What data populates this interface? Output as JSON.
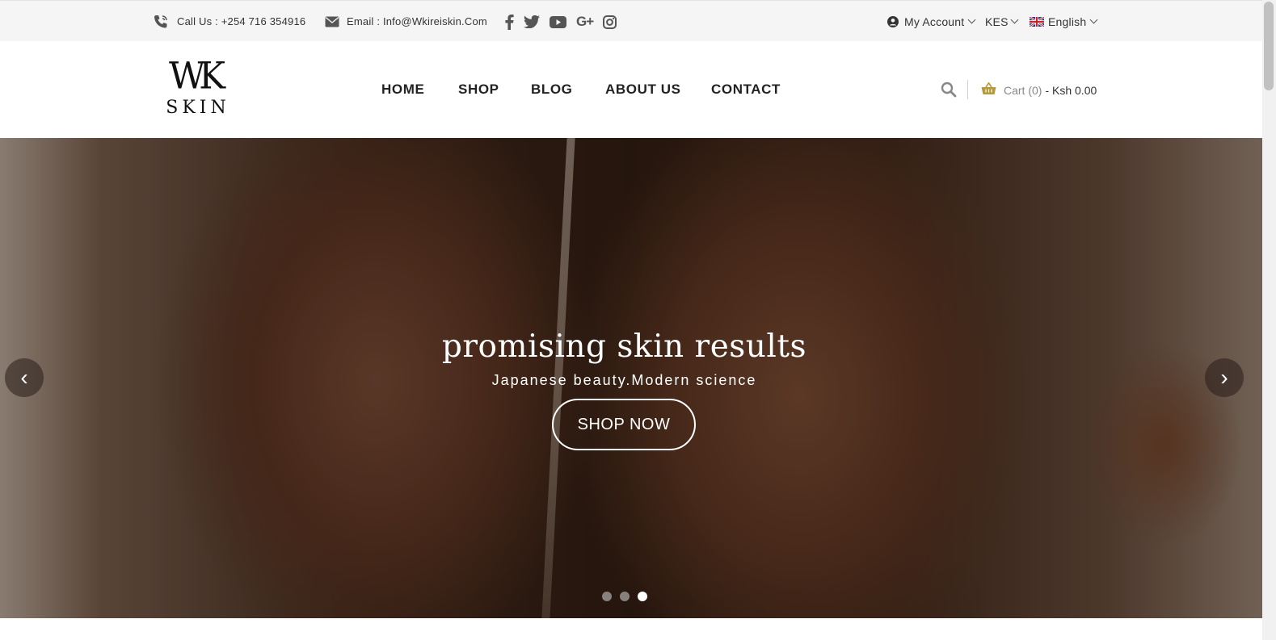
{
  "topbar": {
    "phone_label": "Call Us : +254 716 354916",
    "email_label": "Email : Info@Wkireiskin.Com",
    "social_icons": [
      "facebook-icon",
      "twitter-icon",
      "youtube-icon",
      "google-plus-icon",
      "instagram-icon"
    ],
    "account_label": "My Account",
    "currency_label": "KES",
    "language_label": "English"
  },
  "header": {
    "logo_mark": "WK",
    "logo_word": "SKIN",
    "nav": [
      {
        "label": "HOME"
      },
      {
        "label": "SHOP"
      },
      {
        "label": "BLOG"
      },
      {
        "label": "ABOUT US"
      },
      {
        "label": "CONTACT"
      }
    ],
    "cart_label": "Cart (0)",
    "cart_amount": "- Ksh 0.00"
  },
  "hero": {
    "title": "promising skin results",
    "subtitle": "Japanese beauty.Modern science",
    "button_label": "SHOP NOW",
    "prev_label": "‹",
    "next_label": "›",
    "slide_count": 3,
    "active_slide": 3
  },
  "colors": {
    "topbar_bg": "#f5f5f5",
    "accent_cart": "#b59a3c",
    "hero_text": "#ffffff"
  }
}
